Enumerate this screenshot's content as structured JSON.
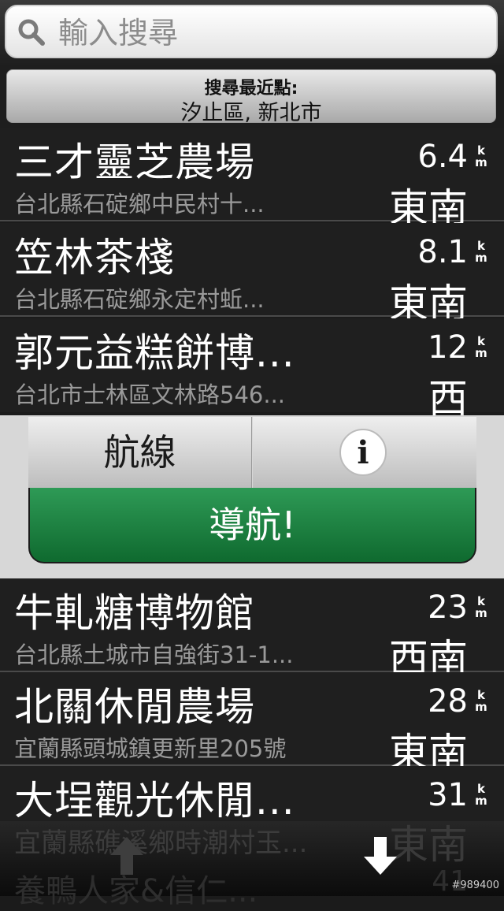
{
  "search": {
    "placeholder": "輸入搜尋"
  },
  "near_point": {
    "label": "搜尋最近點:",
    "value": "汐止區, 新北市"
  },
  "unit": {
    "top": "k",
    "bottom": "m"
  },
  "results_top": [
    {
      "name": "三才靈芝農場",
      "address": "台北縣石碇鄉中民村十...",
      "distance": "6.4",
      "direction": "東南"
    },
    {
      "name": "笠林茶棧",
      "address": "台北縣石碇鄉永定村蚯...",
      "distance": "8.1",
      "direction": "東南"
    },
    {
      "name": "郭元益糕餅博...",
      "address": "台北市士林區文林路546...",
      "distance": "12",
      "direction": "西"
    }
  ],
  "actions": {
    "route_label": "航線",
    "info_icon": "i",
    "navigate_label": "導航!"
  },
  "results_bottom": [
    {
      "name": "牛軋糖博物館",
      "address": "台北縣土城市自強街31-1...",
      "distance": "23",
      "direction": "西南"
    },
    {
      "name": "北關休閒農場",
      "address": "宜蘭縣頭城鎮更新里205號",
      "distance": "28",
      "direction": "東南"
    },
    {
      "name": "大埕觀光休閒...",
      "address": "",
      "distance": "31",
      "direction": ""
    }
  ],
  "ghost": {
    "address": "宜蘭縣礁溪鄉時潮村玉...",
    "direction": "東南",
    "name": "養鴨人家&信仁...",
    "distance": "41"
  },
  "watermark": "#989400"
}
